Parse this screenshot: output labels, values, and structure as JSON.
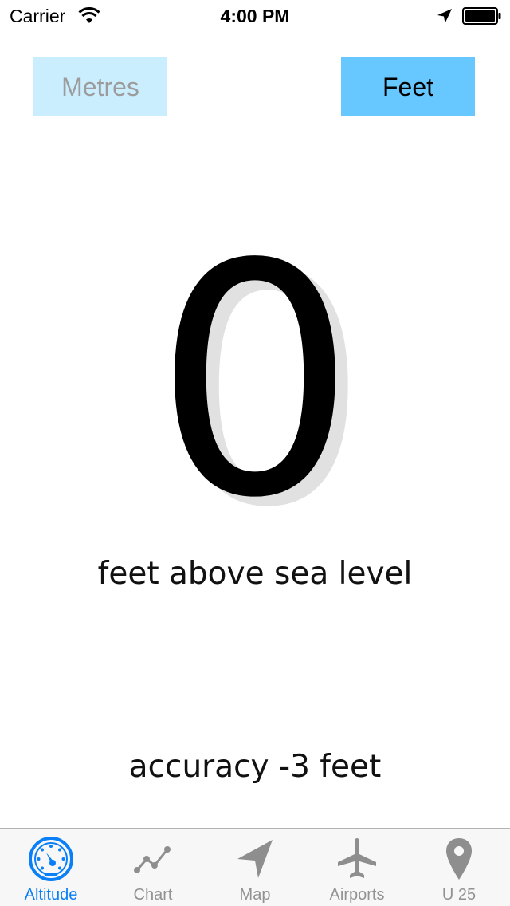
{
  "status_bar": {
    "carrier": "Carrier",
    "time": "4:00 PM",
    "icons": [
      "wifi-icon",
      "location-arrow-icon",
      "battery-icon"
    ]
  },
  "units": {
    "metres_label": "Metres",
    "feet_label": "Feet",
    "selected": "Feet"
  },
  "altitude": {
    "value": "0",
    "caption": "feet above sea level",
    "accuracy": "accuracy -3 feet"
  },
  "tab_bar": {
    "active": "Altitude",
    "tabs": [
      {
        "label": "Altitude",
        "icon": "speedometer-icon"
      },
      {
        "label": "Chart",
        "icon": "line-chart-icon"
      },
      {
        "label": "Map",
        "icon": "navigation-arrow-icon"
      },
      {
        "label": "Airports",
        "icon": "airplane-icon"
      },
      {
        "label": "U 25",
        "icon": "map-pin-icon"
      }
    ]
  },
  "colors": {
    "metres_button_bg": "#cbeeff",
    "feet_button_bg": "#66c8ff",
    "tab_active": "#0a7ff7",
    "tab_inactive": "#929292"
  }
}
